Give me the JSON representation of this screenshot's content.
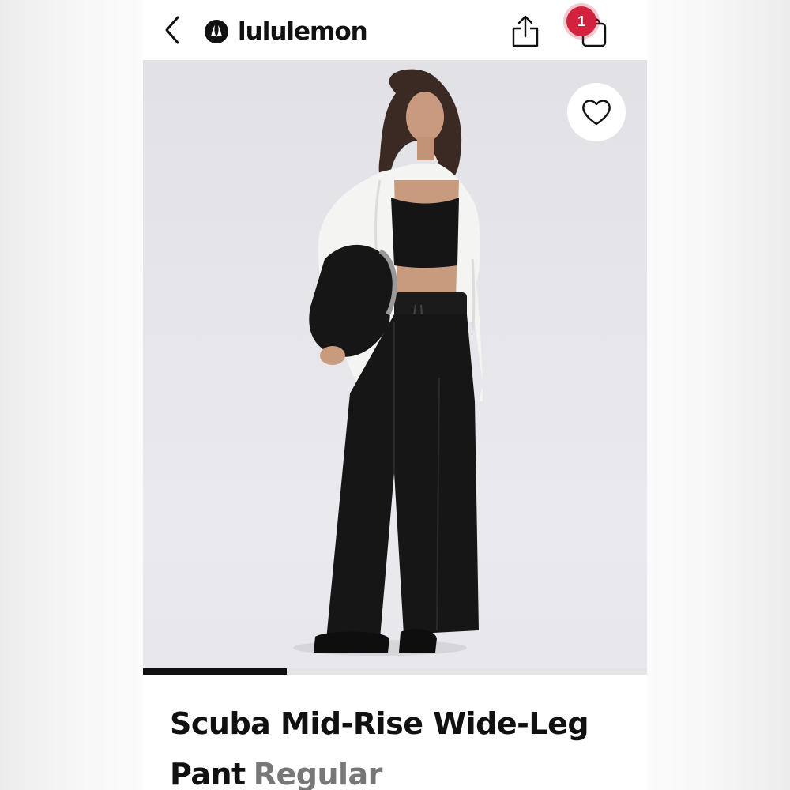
{
  "app": {
    "brand_name": "lululemon",
    "accent_color": "#d3223e"
  },
  "header": {
    "back_icon": "chevron-left-icon",
    "share_icon": "share-icon",
    "bag_icon": "shopping-bag-icon",
    "bag_count": "1"
  },
  "gallery": {
    "wishlist_icon": "heart-icon",
    "progress": 0.285
  },
  "product": {
    "name_line1": "Scuba Mid-Rise Wide-Leg",
    "name_line2": "Pant",
    "variant": "Regular"
  }
}
